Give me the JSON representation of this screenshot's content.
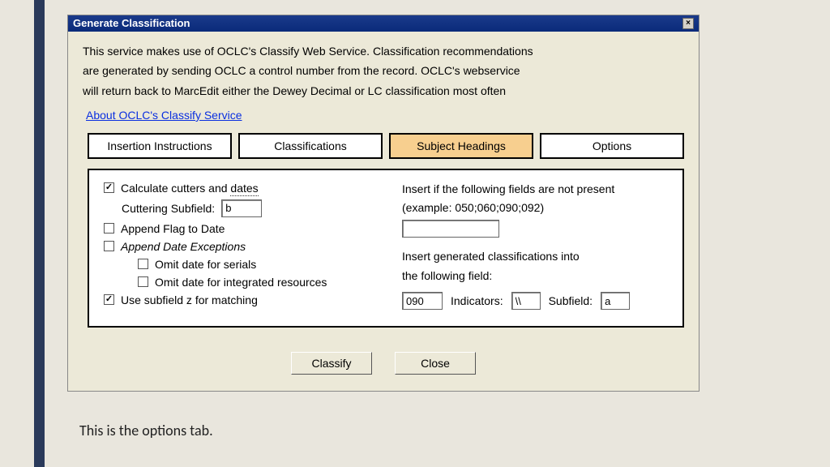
{
  "window": {
    "title": "Generate Classification"
  },
  "description": {
    "line1": "This service makes use of OCLC's Classify Web Service.  Classification recommendations",
    "line2": "are generated by sending OCLC a control number from the record.  OCLC's webservice",
    "line3": "will return back to MarcEdit either the Dewey Decimal or LC classification most often"
  },
  "about_link": "About OCLC's Classify Service",
  "tabs": {
    "insertion": "Insertion Instructions",
    "classifications": "Classifications",
    "subject": "Subject Headings",
    "options": "Options"
  },
  "options": {
    "calc_cutters": {
      "label": "Calculate cutters and",
      "dotted": "dates",
      "checked": true
    },
    "cuttering_subfield": {
      "label": "Cuttering Subfield:",
      "value": "b"
    },
    "append_flag": {
      "label": "Append Flag to Date",
      "checked": false
    },
    "append_exceptions": {
      "label": "Append Date Exceptions",
      "checked": false
    },
    "omit_serials": {
      "label": "Omit date for serials",
      "checked": false
    },
    "omit_integrated": {
      "label": "Omit date for integrated resources",
      "checked": false
    },
    "use_subfield_z": {
      "label": "Use subfield z for matching",
      "checked": true
    }
  },
  "insert_if": {
    "line1": "Insert if the following fields are not present",
    "line2": "(example:  050;060;090;092)",
    "value": ""
  },
  "insert_into": {
    "line1": "Insert generated classifications into",
    "line2": "the following field:",
    "field": "090",
    "indicators_label": "Indicators:",
    "indicators": "\\\\",
    "subfield_label": "Subfield:",
    "subfield": "a"
  },
  "buttons": {
    "classify": "Classify",
    "close": "Close"
  },
  "caption": "This is the options tab."
}
